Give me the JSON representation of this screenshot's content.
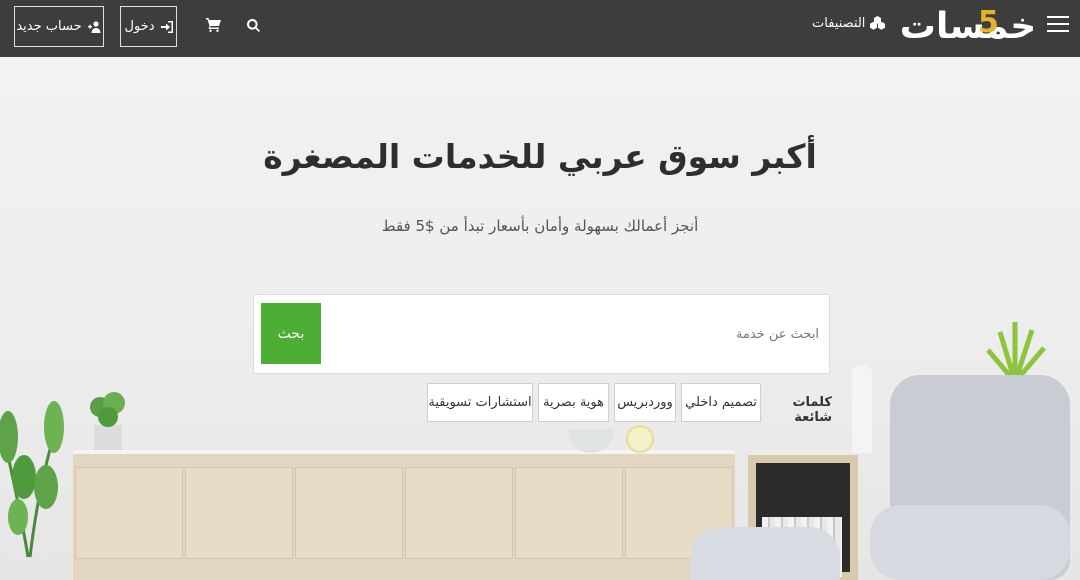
{
  "header": {
    "logo_text": "خمسات",
    "logo_accent": "5",
    "categories_label": "التصنيفات",
    "login_label": "دخول",
    "register_label": "حساب جديد"
  },
  "hero": {
    "title": "أكبر سوق عربي للخدمات المصغرة",
    "subtitle": "أنجز أعمالك بسهولة وأمان بأسعار تبدأ من $5 فقط"
  },
  "search": {
    "placeholder": "ابحث عن خدمة",
    "button_label": "بحث"
  },
  "popular": {
    "label": "كلمات شائعة",
    "tags": [
      "تصميم داخلي",
      "ووردبريس",
      "هوية بصرية",
      "استشارات تسويقية"
    ]
  },
  "colors": {
    "topbar": "#3d3d3d",
    "accent_green": "#4cae35",
    "logo_gold": "#e6b229"
  },
  "icons": {
    "menu": "hamburger-menu-icon",
    "categories": "cubes-icon",
    "search": "search-icon",
    "cart": "shopping-cart-icon",
    "login": "sign-in-icon",
    "register": "user-plus-icon"
  }
}
